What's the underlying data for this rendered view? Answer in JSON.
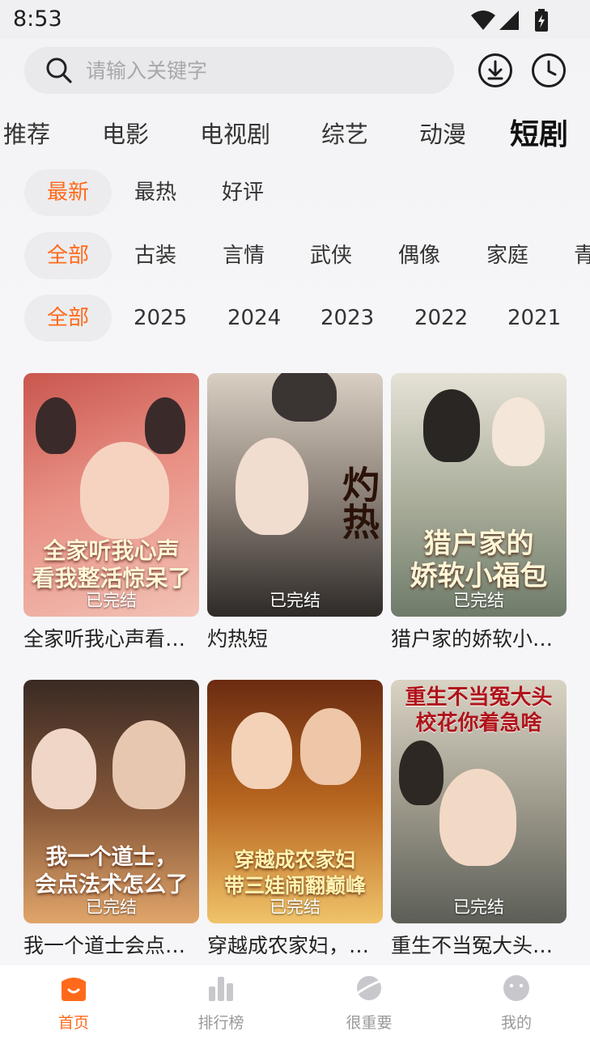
{
  "status": {
    "time": "8:53"
  },
  "search": {
    "placeholder": "请输入关键字"
  },
  "header": {
    "download_icon": "download-icon",
    "history_icon": "clock-icon"
  },
  "category_tabs": [
    {
      "label": "推荐"
    },
    {
      "label": "电影"
    },
    {
      "label": "电视剧"
    },
    {
      "label": "综艺"
    },
    {
      "label": "动漫"
    },
    {
      "label": "短剧",
      "active": true
    }
  ],
  "sort_filters": [
    {
      "label": "最新",
      "selected": true
    },
    {
      "label": "最热"
    },
    {
      "label": "好评"
    }
  ],
  "genre_filters": [
    {
      "label": "全部",
      "selected": true
    },
    {
      "label": "古装"
    },
    {
      "label": "言情"
    },
    {
      "label": "武侠"
    },
    {
      "label": "偶像"
    },
    {
      "label": "家庭"
    },
    {
      "label": "青"
    }
  ],
  "year_filters": [
    {
      "label": "全部",
      "selected": true
    },
    {
      "label": "2025"
    },
    {
      "label": "2024"
    },
    {
      "label": "2023"
    },
    {
      "label": "2022"
    },
    {
      "label": "2021"
    }
  ],
  "cards": [
    {
      "title": "全家听我心声看…",
      "poster_text": "全家听我心声\n看我整活惊呆了",
      "badge": "已完结",
      "colors": [
        "#c9564e",
        "#f3c2b6"
      ]
    },
    {
      "title": "灼热短",
      "poster_text": "灼热",
      "badge": "已完结",
      "colors": [
        "#4a4540",
        "#d9cfc3"
      ]
    },
    {
      "title": "猎户家的娇软小…",
      "poster_text": "猎户家的\n娇软小福包",
      "badge": "已完结",
      "colors": [
        "#6f7b6a",
        "#e6e2d6"
      ]
    },
    {
      "title": "我一个道士会点…",
      "poster_text": "我一个道士，\n会点法术怎么了",
      "badge": "已完结",
      "colors": [
        "#3a2a24",
        "#e0a56a"
      ]
    },
    {
      "title": "穿越成农家妇，…",
      "poster_text": "穿越成农家妇\n带三娃闹翻巅峰",
      "badge": "已完结",
      "colors": [
        "#8a4a1c",
        "#f0c36a"
      ]
    },
    {
      "title": "重生不当冤大头…",
      "poster_text": "重生不当冤大头\n校花你着急啥",
      "badge": "已完结",
      "colors": [
        "#5c5e57",
        "#d9d3c4"
      ]
    }
  ],
  "tabbar": [
    {
      "label": "首页",
      "icon": "home-icon",
      "active": true
    },
    {
      "label": "排行榜",
      "icon": "chart-icon"
    },
    {
      "label": "很重要",
      "icon": "planet-icon"
    },
    {
      "label": "我的",
      "icon": "face-icon"
    }
  ],
  "colors": {
    "accent": "#ff6a1a",
    "chip_bg": "#ececef",
    "inactive": "#999999"
  }
}
